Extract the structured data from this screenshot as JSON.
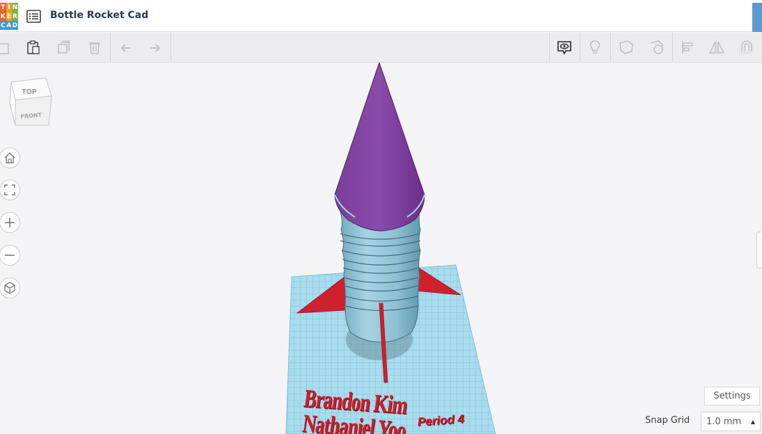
{
  "app": {
    "logo_letters": [
      "T",
      "I",
      "N",
      "K",
      "E",
      "R",
      "C",
      "A",
      "D"
    ],
    "logo_colors": [
      "#e5652a",
      "#f0a12c",
      "#7cb342",
      "#e5652a",
      "#f0a12c",
      "#7cb342",
      "#2f9fd6",
      "#2f9fd6",
      "#2f9fd6"
    ]
  },
  "header": {
    "design_title": "Bottle Rocket Cad",
    "menu_icon": "list-icon"
  },
  "toolbar": {
    "left": [
      "copy-icon",
      "paste-icon",
      "duplicate-icon",
      "delete-icon",
      "undo-icon",
      "redo-icon"
    ],
    "right": [
      "show-notes-icon",
      "lightbulb-icon",
      "shape-hole-icon",
      "group-icon",
      "align-icon",
      "mirror-icon",
      "magnet-icon"
    ]
  },
  "viewcube": {
    "top": "TOP",
    "front": "FRONT"
  },
  "nav": [
    "home-view-icon",
    "fit-view-icon",
    "zoom-in-icon",
    "zoom-out-icon",
    "perspective-icon"
  ],
  "scene": {
    "text_line_1": "Brandon Kim",
    "text_line_2": "Nathaniel Yoo",
    "text_period": "Period 4",
    "colors": {
      "cone": "#7a3b9a",
      "body": "#8fc3d6",
      "fins": "#d0202b",
      "plate": "#a9dced",
      "grid_line": "#6fb8d6"
    }
  },
  "footer": {
    "settings_label": "Settings",
    "snap_grid_label": "Snap Grid",
    "snap_grid_value": "1.0 mm"
  }
}
